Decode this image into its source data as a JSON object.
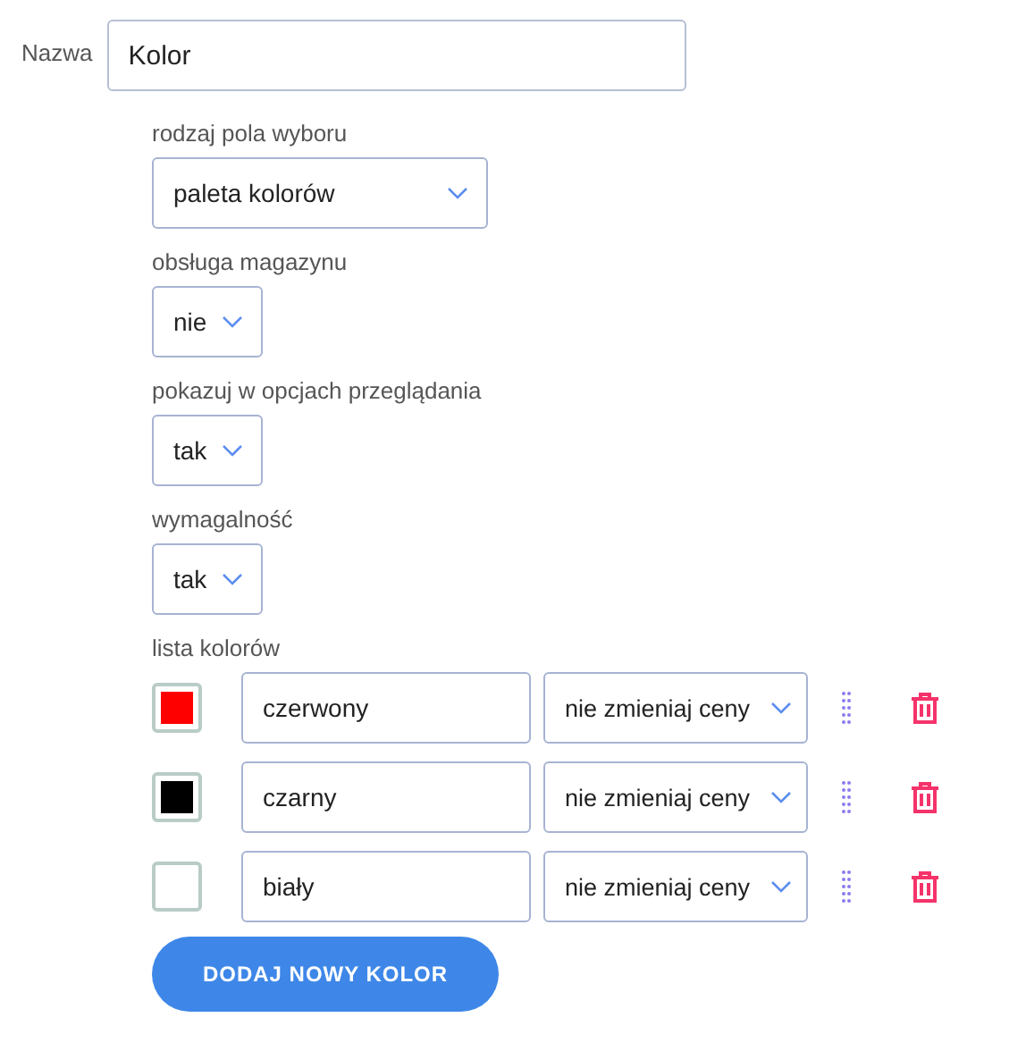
{
  "name_field": {
    "label": "Nazwa",
    "value": "Kolor"
  },
  "settings": [
    {
      "label": "rodzaj pola wyboru",
      "value": "paleta kolorów",
      "kind": "wide"
    },
    {
      "label": "obsługa magazynu",
      "value": "nie",
      "kind": "narrow"
    },
    {
      "label": "pokazuj w opcjach przeglądania",
      "value": "tak",
      "kind": "narrow"
    },
    {
      "label": "wymagalność",
      "value": "tak",
      "kind": "narrow"
    }
  ],
  "colors_list": {
    "label": "lista kolorów",
    "items": [
      {
        "color": "#ff0000",
        "name": "czerwony",
        "price": "nie zmieniaj ceny"
      },
      {
        "color": "#000000",
        "name": "czarny",
        "price": "nie zmieniaj ceny"
      },
      {
        "color": "#ffffff",
        "name": "biały",
        "price": "nie zmieniaj ceny"
      }
    ]
  },
  "add_button": "DODAJ NOWY KOLOR"
}
